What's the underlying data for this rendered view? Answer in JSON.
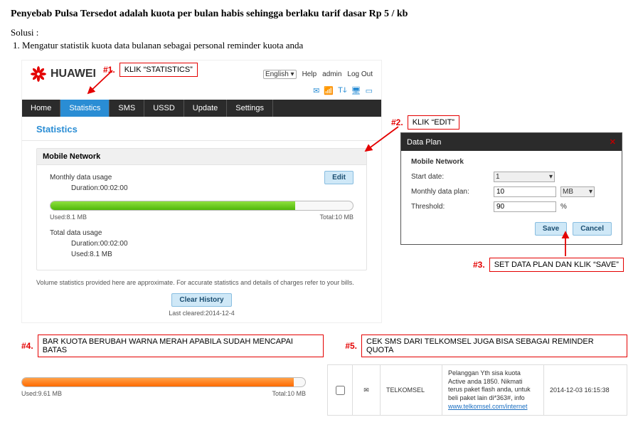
{
  "title": "Penyebab Pulsa Tersedot adalah kuota per bulan habis sehingga berlaku tarif dasar Rp 5 / kb",
  "solusi_label": "Solusi  :",
  "step1": "1.   Mengatur statistik kuota data bulanan sebagai personal reminder kuota anda",
  "ann": {
    "n1": "#1.",
    "t1": "KLIK “STATISTICS”",
    "n2": "#2.",
    "t2": "KLIK “EDIT”",
    "n3": "#3.",
    "t3": "SET DATA PLAN DAN KLIK “SAVE”",
    "n4": "#4.",
    "t4": "BAR KUOTA BERUBAH WARNA MERAH APABILA SUDAH MENCAPAI BATAS",
    "n5": "#5.",
    "t5": "CEK SMS DARI TELKOMSEL JUGA BISA SEBAGAI REMINDER QUOTA"
  },
  "admin": {
    "brand": "HUAWEI",
    "lang": "English",
    "help": "Help",
    "user": "admin",
    "logout": "Log Out",
    "menu": [
      "Home",
      "Statistics",
      "SMS",
      "USSD",
      "Update",
      "Settings"
    ],
    "page_heading": "Statistics",
    "panel_title": "Mobile Network",
    "monthly_label": "Monthly data usage",
    "duration_label": "Duration:00:02:00",
    "used_label": "Used:8.1 MB",
    "total_label": "Total:10 MB",
    "total_section": "Total data usage",
    "edit": "Edit",
    "note": "Volume statistics provided here are approximate. For accurate statistics and details of charges refer to your bills.",
    "clear": "Clear History",
    "last_cleared": "Last cleared:2014-12-4"
  },
  "dlg": {
    "title": "Data Plan",
    "sub": "Mobile Network",
    "start_date_lbl": "Start date:",
    "start_date_val": "1",
    "mdp_lbl": "Monthly data plan:",
    "mdp_val": "10",
    "mdp_unit": "MB",
    "thr_lbl": "Threshold:",
    "thr_val": "90",
    "thr_unit": "%",
    "save": "Save",
    "cancel": "Cancel"
  },
  "redbar": {
    "used": "Used:9.61 MB",
    "total": "Total:10 MB"
  },
  "sms": {
    "sender": "TELKOMSEL",
    "body": "Pelanggan Yth sisa kuota Active anda 1850. Nikmati terus paket flash anda, untuk beli paket lain di*363#, info ",
    "link": "www.telkomsel.com/internet",
    "time": "2014-12-03 16:15:38"
  }
}
